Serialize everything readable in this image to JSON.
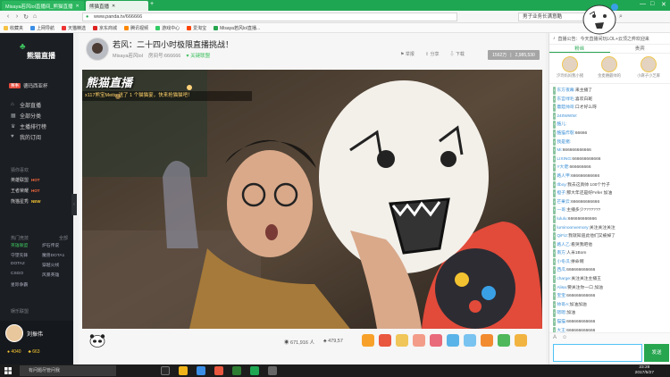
{
  "colors": {
    "accent": "#27a64f",
    "sidebar_bg": "#1b1e23",
    "hot": "#ff6b3d",
    "new": "#ffcc33",
    "room_stats_bg": "#a5a5a5"
  },
  "browser": {
    "tabs": [
      {
        "title": "Misaya若风lol直播间_熊猫直播",
        "active": false
      },
      {
        "title": "熊猫直播",
        "active": true
      }
    ],
    "url": "www.panda.tv/666666",
    "search_text": "男子业务长满意酷"
  },
  "bookmarks": [
    "收藏夹",
    "上网导航",
    "天猫精选",
    "京东商城",
    "腾讯视频",
    "游戏中心",
    "爱淘宝",
    "Misaya若风lol直播..."
  ],
  "sidebar": {
    "logo_text": "熊猫直播",
    "cup_badge": "赛事",
    "cup_label": "德玛西亚杯",
    "main_nav": [
      {
        "icon": "home-icon",
        "label": "全部直播"
      },
      {
        "icon": "grid-icon",
        "label": "全部分类"
      },
      {
        "icon": "trophy-icon",
        "label": "主播排行榜"
      },
      {
        "icon": "heart-icon",
        "label": "我的订阅"
      }
    ],
    "hot_header": "猜你喜欢",
    "tags": [
      {
        "label": "英雄联盟",
        "badge": "HOT"
      },
      {
        "label": "王者荣耀",
        "badge": "HOT"
      },
      {
        "label": "熊猫星秀",
        "badge": "NEW"
      }
    ],
    "games_header": "热门竞技",
    "games_header_more": "全部",
    "games": [
      "英雄联盟",
      "炉石传说",
      "守望先锋",
      "魔兽DOTA1",
      "DOTA2",
      "穿越火线",
      "CSGO",
      "风暴英雄",
      "星际争霸",
      ""
    ],
    "entertainment_header": "娱乐联盟",
    "user": {
      "name": "刘振伟",
      "coins": "4040",
      "bamboo": "663"
    }
  },
  "room": {
    "title": "若风：二十四小时极限直播挑战！",
    "streamer": "Misaya若风lol",
    "room_id": "房间号:666666",
    "follow_label": "关键联盟",
    "actions": [
      "举报",
      "分享",
      "下载"
    ],
    "stats_left": "1562万",
    "stats_right": "2,985,530",
    "viewers": "671,916 人",
    "bamboo_count": "479,57"
  },
  "video": {
    "watermark": "熊猫直播",
    "banner": "x117熊宝Meito 送了 1 个猫猫宴，快来抢猫猫吧！"
  },
  "chat": {
    "announcement": "直播公告：今天直播间玩LOL+云顶之弈欢迎来",
    "tabs": [
      "粉丝",
      "贵宾"
    ],
    "rank": [
      {
        "name": "汐玲妈妈我小猪"
      },
      {
        "name": "金麦穗最帅的"
      },
      {
        "name": "小麻子小芝麻"
      }
    ],
    "messages": [
      {
        "user": "东方夜幕:",
        "text": "来主播了"
      },
      {
        "user": "东宫绿毛:",
        "text": "喜欢白斑"
      },
      {
        "user": "蘑菇帅哥:",
        "text": "口才好么呀"
      },
      {
        "user": "240WWW:",
        "text": ""
      },
      {
        "user": "酷儿:",
        "text": ""
      },
      {
        "user": "酷猫炸裂:",
        "text": "66666"
      },
      {
        "user": "我是猪:",
        "text": ""
      },
      {
        "user": "Mi:",
        "text": "666666666666"
      },
      {
        "user": "LIXING:",
        "text": "666666666666"
      },
      {
        "user": "Y大佬:",
        "text": "666666666"
      },
      {
        "user": "路人甲:",
        "text": "666666666666"
      },
      {
        "user": "tfboy:",
        "text": "我去这真帅 100个竹子"
      },
      {
        "user": "橙子:",
        "text": "那大年还是好Fefer 加油"
      },
      {
        "user": "芒果云:",
        "text": "666666666666"
      },
      {
        "user": "一哥:",
        "text": "主播多少???????"
      },
      {
        "user": "lululu:",
        "text": "666666666666"
      },
      {
        "user": "luminoonvemory:",
        "text": "关注关注关注"
      },
      {
        "user": "QiFi2:",
        "text": "我就知道此他们又被掉了"
      },
      {
        "user": "路人乙:",
        "text": "看哭我吧他"
      },
      {
        "user": "南方:",
        "text": "人米1Bom"
      },
      {
        "user": "小冬瓜:",
        "text": "拼命啊"
      },
      {
        "user": "西瓜:",
        "text": "666666666666"
      },
      {
        "user": "charge:",
        "text": "关注关注主播王"
      },
      {
        "user": "Alisa:",
        "text": "要关注你一口 加油"
      },
      {
        "user": "宝宝:",
        "text": "666666666666"
      },
      {
        "user": "帅哥A:",
        "text": "加油加油"
      },
      {
        "user": "嗯嗯:",
        "text": "加油"
      },
      {
        "user": "猫猫:",
        "text": "666666666666"
      },
      {
        "user": "大王:",
        "text": "666666666666"
      },
      {
        "user": "蛤蛤:",
        "text": "关注加油主播王"
      },
      {
        "user": "xxf1:",
        "text": "666666666"
      },
      {
        "user": "橙子2:",
        "text": "666666666666"
      },
      {
        "user": "Luss9:",
        "text": "跑跑"
      },
      {
        "user": "lovexyz:",
        "text": "拍模"
      },
      {
        "user": "苹果:",
        "text": "666"
      }
    ],
    "send_label": "发送"
  },
  "taskbar": {
    "search_placeholder": "有问题尽管问我",
    "time": "23:28",
    "date": "2017/5/27"
  }
}
